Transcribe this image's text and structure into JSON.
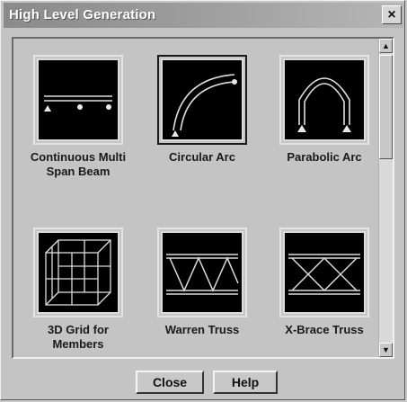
{
  "window": {
    "title": "High Level Generation",
    "close_glyph": "×"
  },
  "gallery": {
    "items": [
      {
        "label": "Continuous Multi Span Beam",
        "icon": "continuous-beam-icon",
        "selected": false
      },
      {
        "label": "Circular Arc",
        "icon": "circular-arc-icon",
        "selected": true
      },
      {
        "label": "Parabolic Arc",
        "icon": "parabolic-arc-icon",
        "selected": false
      },
      {
        "label": "3D Grid for Members",
        "icon": "3d-grid-icon",
        "selected": false
      },
      {
        "label": "Warren Truss",
        "icon": "warren-truss-icon",
        "selected": false
      },
      {
        "label": "X-Brace Truss",
        "icon": "x-brace-truss-icon",
        "selected": false
      }
    ]
  },
  "scrollbar": {
    "up_glyph": "▲",
    "down_glyph": "▼"
  },
  "buttons": {
    "close": "Close",
    "help": "Help"
  }
}
